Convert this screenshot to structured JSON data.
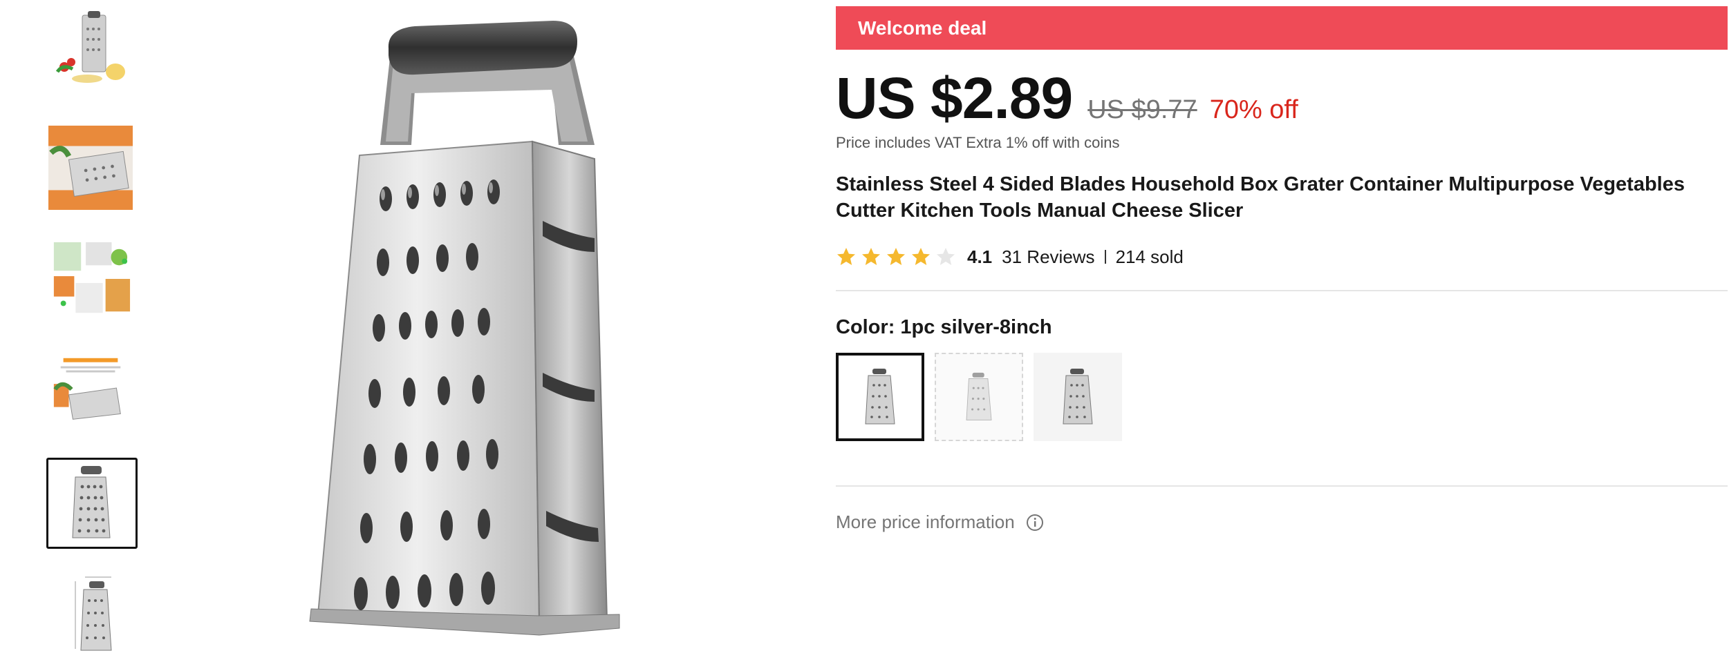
{
  "deal": {
    "label": "Welcome deal",
    "color": "#ef4b57"
  },
  "price": {
    "current": "US $2.89",
    "original": "US $9.77",
    "discount": "70% off",
    "note": "Price includes VAT Extra 1% off with coins"
  },
  "product": {
    "title": "Stainless Steel 4 Sided Blades Household Box Grater Container Multipurpose Vegetables Cutter Kitchen Tools Manual Cheese Slicer"
  },
  "rating": {
    "score": "4.1",
    "stars_filled": 4,
    "stars_total": 5,
    "reviews": "31 Reviews",
    "sold": "214 sold",
    "star_color": "#f5b82e"
  },
  "color_option": {
    "label": "Color: 1pc silver-8inch",
    "swatch_count": 3,
    "selected_index": 0
  },
  "more_price": {
    "label": "More price information",
    "icon": "info-icon"
  },
  "thumbnails": {
    "count": 6,
    "selected_index": 4
  },
  "colors": {
    "accent": "#ef4b57",
    "discount": "#d9261c",
    "muted": "#757575"
  }
}
